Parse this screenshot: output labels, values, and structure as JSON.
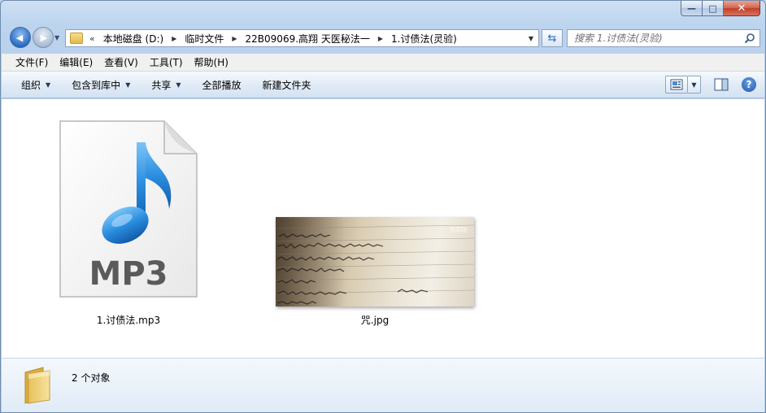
{
  "window": {
    "caption": {
      "minimize": "—",
      "maximize": "□",
      "close": "✕"
    }
  },
  "nav": {
    "back_glyph": "◀",
    "forward_glyph": "▶",
    "breadcrumbs": [
      {
        "label": "本地磁盘 (D:)"
      },
      {
        "label": "临时文件"
      },
      {
        "label": "22B09069.高翔 天医秘法一"
      },
      {
        "label": "1.讨债法(灵验)"
      }
    ],
    "search_placeholder": "搜索 1.讨债法(灵验)"
  },
  "menu": [
    {
      "label": "文件(F)"
    },
    {
      "label": "编辑(E)"
    },
    {
      "label": "查看(V)"
    },
    {
      "label": "工具(T)"
    },
    {
      "label": "帮助(H)"
    }
  ],
  "commands": [
    {
      "label": "组织",
      "has_dropdown": true
    },
    {
      "label": "包含到库中",
      "has_dropdown": true
    },
    {
      "label": "共享",
      "has_dropdown": true
    },
    {
      "label": "全部播放",
      "has_dropdown": false
    },
    {
      "label": "新建文件夹",
      "has_dropdown": false
    }
  ],
  "files": [
    {
      "name": "1.讨债法.mp3",
      "type": "mp3",
      "icon_text": "MP3"
    },
    {
      "name": "咒.jpg",
      "type": "jpg",
      "watermark": "仿高翔"
    }
  ],
  "details": {
    "count_text": "2 个对象"
  },
  "colors": {
    "window_frame": "#bcd4ee",
    "music_note": "#2a8ee0",
    "mp3_text": "#5a5a5a"
  }
}
